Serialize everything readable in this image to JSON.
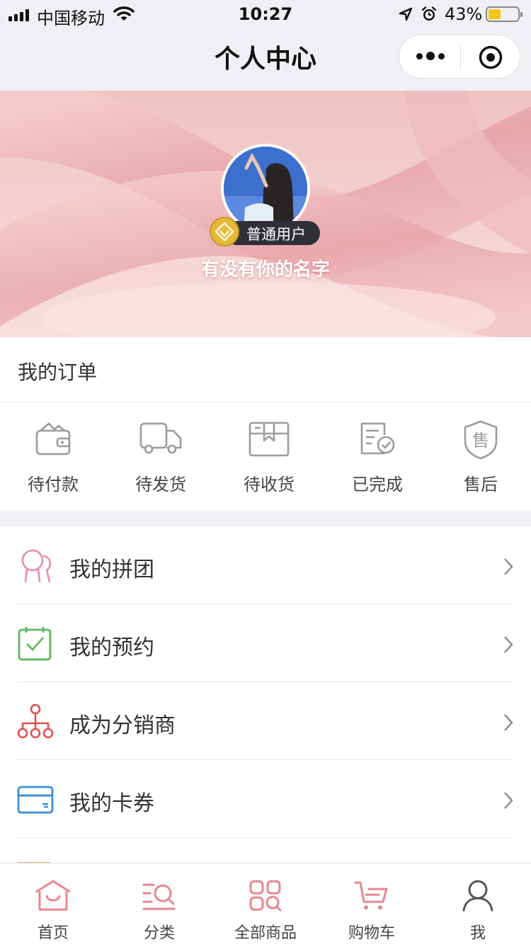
{
  "status_bar": {
    "carrier": "中国移动",
    "time": "10:27",
    "battery_percent": "43%",
    "battery_level": 0.43,
    "icons": [
      "signal-icon",
      "wifi-icon",
      "location-arrow-icon",
      "alarm-icon",
      "battery-icon"
    ]
  },
  "nav": {
    "title": "个人中心",
    "capsule_icons": [
      "more-dots-icon",
      "close-target-icon"
    ]
  },
  "profile": {
    "level_badge": "普通用户",
    "username": "有没有你的名字"
  },
  "orders": {
    "title": "我的订单",
    "items": [
      {
        "label": "待付款",
        "icon": "wallet-icon"
      },
      {
        "label": "待发货",
        "icon": "truck-icon"
      },
      {
        "label": "待收货",
        "icon": "package-icon"
      },
      {
        "label": "已完成",
        "icon": "completed-doc-icon"
      },
      {
        "label": "售后",
        "icon": "after-sale-shield-icon"
      }
    ]
  },
  "menu": {
    "items": [
      {
        "label": "我的拼团",
        "icon": "group-buy-icon"
      },
      {
        "label": "我的预约",
        "icon": "calendar-check-icon"
      },
      {
        "label": "成为分销商",
        "icon": "distribution-tree-icon"
      },
      {
        "label": "我的卡券",
        "icon": "card-icon"
      }
    ]
  },
  "tabbar": {
    "items": [
      {
        "label": "首页",
        "icon": "home-icon"
      },
      {
        "label": "分类",
        "icon": "category-search-icon"
      },
      {
        "label": "全部商品",
        "icon": "all-products-icon"
      },
      {
        "label": "购物车",
        "icon": "cart-icon"
      },
      {
        "label": "我",
        "icon": "user-icon"
      }
    ]
  },
  "colors": {
    "accent_pink": "#e8868f",
    "icon_gray": "#9b9b9b",
    "green_icon": "#5cb85c",
    "red_icon": "#e05050",
    "blue_icon": "#3a8fd8",
    "background_gray": "#efeff4",
    "banner_pink": "#f3c8c8"
  }
}
